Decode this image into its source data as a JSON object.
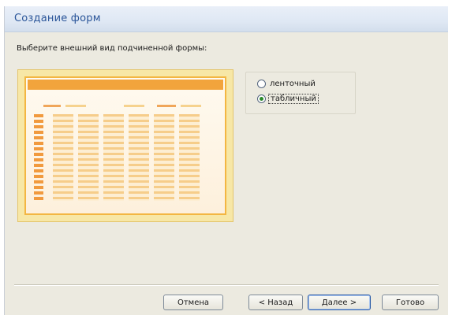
{
  "window": {
    "title": "Создание форм"
  },
  "prompt": "Выберите внешний вид подчиненной формы:",
  "options": [
    {
      "label": "ленточный",
      "selected": false
    },
    {
      "label": "табличный",
      "selected": true
    }
  ],
  "buttons": {
    "cancel": "Отмена",
    "back": "< Назад",
    "next": "Далее >",
    "finish": "Готово"
  }
}
